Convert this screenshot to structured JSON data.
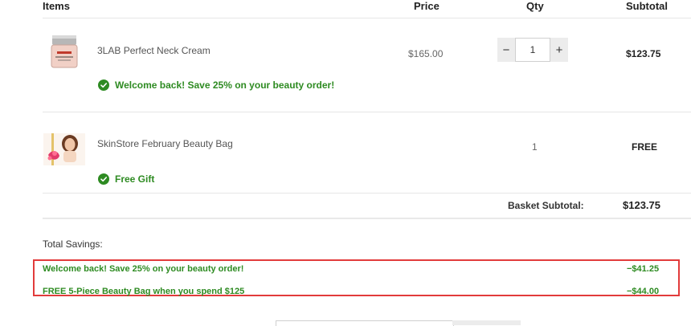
{
  "table": {
    "headers": {
      "items": "Items",
      "price": "Price",
      "qty": "Qty",
      "subtotal": "Subtotal"
    },
    "rows": [
      {
        "name": "3LAB Perfect Neck Cream",
        "price": "$165.00",
        "qty": "1",
        "subtotal": "$123.75",
        "promo": "Welcome back! Save 25% on your beauty order!"
      },
      {
        "name": "SkinStore February Beauty Bag",
        "price": "",
        "qty": "1",
        "subtotal": "FREE",
        "promo": "Free Gift"
      }
    ],
    "qty_minus": "−",
    "qty_plus": "+"
  },
  "basket": {
    "label": "Basket Subtotal:",
    "value": "$123.75"
  },
  "savings": {
    "title": "Total Savings:",
    "items": [
      {
        "label": "Welcome back! Save 25% on your beauty order!",
        "amount": "−$41.25"
      },
      {
        "label": "FREE 5-Piece Beauty Bag when you spend $125",
        "amount": "−$44.00"
      }
    ]
  },
  "colors": {
    "promo_green": "#2e8b22",
    "highlight_red": "#e23b3b"
  },
  "icons": {
    "check": "check-circle-icon"
  }
}
